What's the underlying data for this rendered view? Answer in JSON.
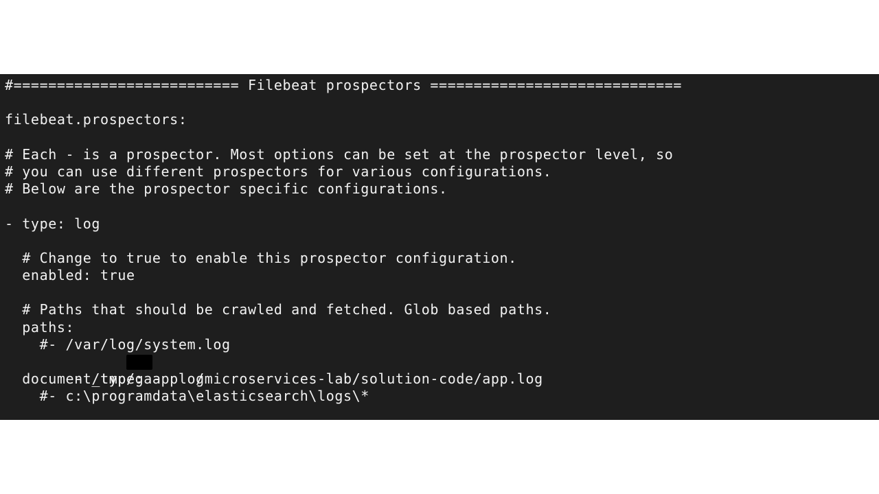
{
  "terminal": {
    "lines": [
      "#========================== Filebeat prospectors =============================",
      "",
      "filebeat.prospectors:",
      "",
      "# Each - is a prospector. Most options can be set at the prospector level, so",
      "# you can use different prospectors for various configurations.",
      "# Below are the prospector specific configurations.",
      "",
      "- type: log",
      "",
      "  # Change to true to enable this prospector configuration.",
      "  enabled: true",
      "",
      "  # Paths that should be crawled and fetched. Glob based paths.",
      "  paths:",
      "    #- /var/log/system.log",
      "    - /tmp/ga-    /microservices-lab/solution-code/app.log",
      "  document_type: applog",
      "    #- c:\\programdata\\elasticsearch\\logs\\*"
    ]
  }
}
